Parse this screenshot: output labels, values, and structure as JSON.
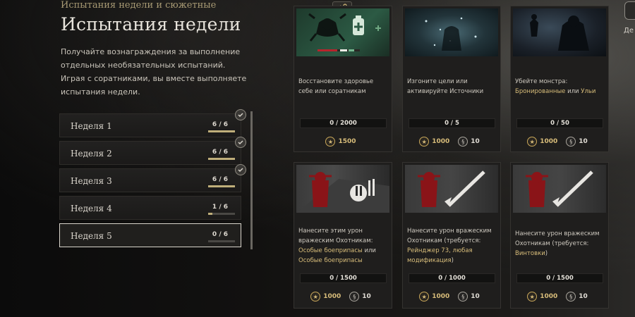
{
  "header": {
    "breadcrumb": "Испытания недели и сюжетные",
    "title": "Испытания недели",
    "description": "Получайте вознаграждения за выполнение отдельных необязательных испытаний. Играя с соратниками, вы вместе выполняете испытания недели."
  },
  "weeks": [
    {
      "label": "Неделя 1",
      "progress": "6 / 6",
      "fraction": 1.0,
      "completed": true
    },
    {
      "label": "Неделя 2",
      "progress": "6 / 6",
      "fraction": 1.0,
      "completed": true
    },
    {
      "label": "Неделя 3",
      "progress": "6 / 6",
      "fraction": 1.0,
      "completed": true
    },
    {
      "label": "Неделя 4",
      "progress": "1 / 6",
      "fraction": 0.17,
      "completed": false
    },
    {
      "label": "Неделя 5",
      "progress": "0 / 6",
      "fraction": 0.0,
      "completed": false,
      "selected": true
    }
  ],
  "cards": [
    {
      "text": "Восстановите здоровье себе или соратникам",
      "progress": "0 / 2000",
      "xp": "1500",
      "bm": ""
    },
    {
      "text": "Изгоните цели или активируйте Источники",
      "progress": "0 / 5",
      "xp": "1000",
      "bm": "10"
    },
    {
      "text_prefix": "Убейте монстра:",
      "text_hl1": "Бронированные",
      "text_mid": " или ",
      "text_hl2": "Ульи",
      "progress": "0 / 50",
      "xp": "1000",
      "bm": "10"
    },
    {
      "text_prefix": "Нанесите этим урон вражеским Охотникам: ",
      "text_hl1": "Особые боеприпасы",
      "text_mid": " или ",
      "text_hl2": "Особые боеприпасы",
      "progress": "0 / 1500",
      "xp": "1000",
      "bm": "10"
    },
    {
      "text_prefix": "Нанесите урон вражеским Охотникам (требуется: ",
      "text_hl1": "Рейнджер 73, любая модификация",
      "text_suffix": ")",
      "progress": "0 / 1000",
      "xp": "1000",
      "bm": "10"
    },
    {
      "text_prefix": "Нанесите урон вражеским Охотникам (требуется: ",
      "text_hl1": "Винтовки",
      "text_suffix": ")",
      "progress": "0 / 1500",
      "xp": "1000",
      "bm": "10"
    }
  ],
  "corner": {
    "label": "Дe"
  },
  "colors": {
    "accent": "#d8bd7a",
    "progress_fill": "#bfae7a",
    "danger": "#c0202a"
  },
  "icons": {
    "xp": "star-medal-icon",
    "bm": "scroll-coin-icon",
    "check": "check-icon"
  }
}
